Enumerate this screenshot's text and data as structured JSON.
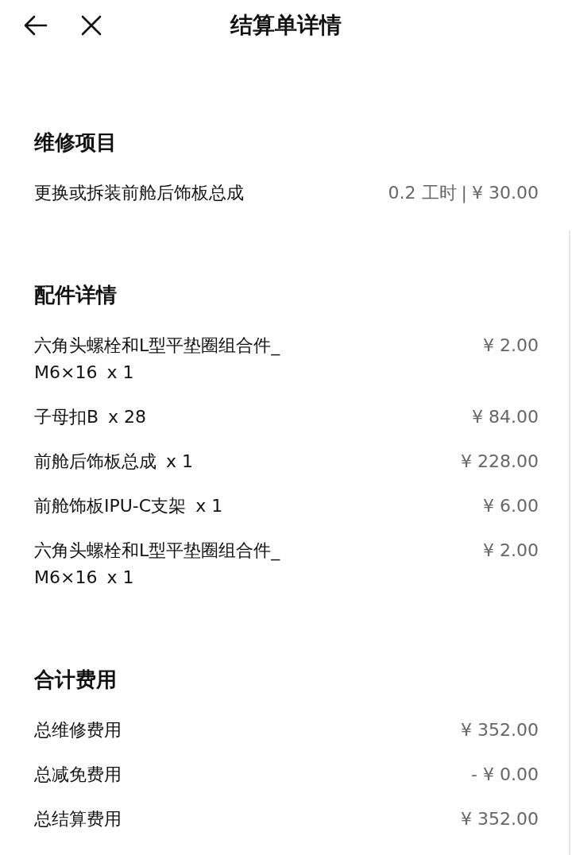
{
  "header": {
    "title": "结算单详情"
  },
  "sections": [
    {
      "kind": "labor",
      "title": "维修项目",
      "rows": [
        {
          "name": "更换或拆装前舱后饰板总成",
          "hours": "0.2 工时",
          "separator": "|",
          "price": "¥ 30.00"
        }
      ]
    },
    {
      "kind": "parts",
      "title": "配件详情",
      "rows": [
        {
          "name": "六角头螺栓和L型平垫圈组合件_M6×16",
          "qty": "x 1",
          "price": "¥ 2.00"
        },
        {
          "name": "子母扣B",
          "qty": "x 28",
          "price": "¥ 84.00"
        },
        {
          "name": "前舱后饰板总成",
          "qty": "x 1",
          "price": "¥ 228.00"
        },
        {
          "name": "前舱饰板IPU-C支架",
          "qty": "x 1",
          "price": "¥ 6.00"
        },
        {
          "name": "六角头螺栓和L型平垫圈组合件_M6×16",
          "qty": "x 1",
          "price": "¥ 2.00"
        }
      ]
    },
    {
      "kind": "totals",
      "title": "合计费用",
      "rows": [
        {
          "name": "总维修费用",
          "price": "¥ 352.00"
        },
        {
          "name": "总减免费用",
          "price": "- ¥ 0.00"
        },
        {
          "name": "总结算费用",
          "price": "¥ 352.00"
        }
      ]
    }
  ]
}
